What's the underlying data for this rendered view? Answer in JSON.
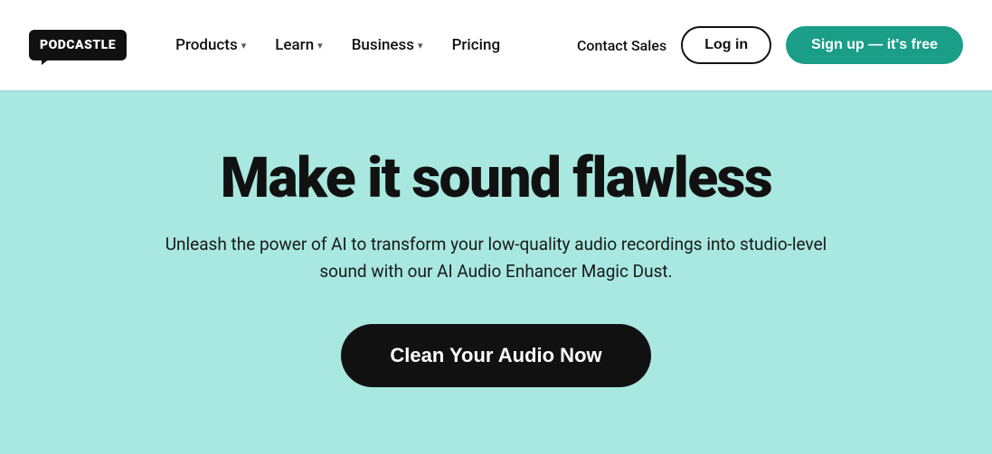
{
  "navbar": {
    "logo_text": "PODCASTLE",
    "nav_items": [
      {
        "label": "Products",
        "has_chevron": true
      },
      {
        "label": "Learn",
        "has_chevron": true
      },
      {
        "label": "Business",
        "has_chevron": true
      },
      {
        "label": "Pricing",
        "has_chevron": false
      }
    ],
    "contact_sales_label": "Contact Sales",
    "login_label": "Log in",
    "signup_label": "Sign up — it's free"
  },
  "hero": {
    "title": "Make it sound flawless",
    "subtitle": "Unleash the power of AI to transform your low-quality audio recordings into studio-level sound with our AI Audio Enhancer Magic Dust.",
    "cta_label": "Clean Your Audio Now"
  },
  "colors": {
    "hero_bg": "#a8e8e0",
    "cta_bg": "#111111",
    "signup_bg": "#1a9e87"
  }
}
